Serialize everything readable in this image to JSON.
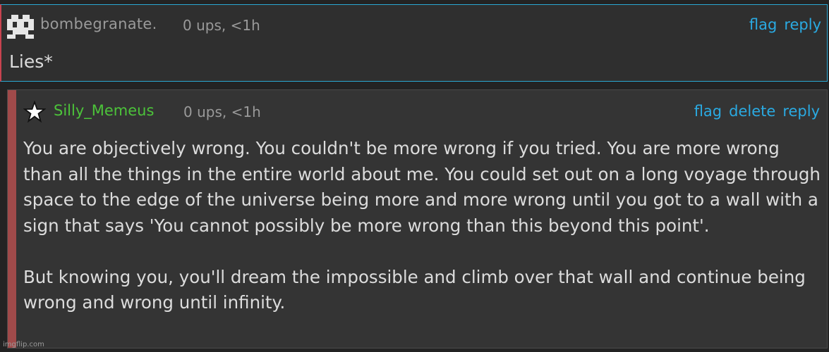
{
  "comment_1": {
    "username": "bombegranate.",
    "meta": "0 ups, <1h",
    "actions": [
      "flag",
      "reply"
    ],
    "text": "Lies*"
  },
  "comment_2": {
    "username": "Silly_Memeus",
    "meta": "0 ups, <1h",
    "actions": [
      "flag",
      "delete",
      "reply"
    ],
    "paragraphs": [
      "You are objectively wrong. You couldn't be more wrong if you tried. You are more wrong than all the things in the entire world about me. You could set out on a long voyage through space to the edge of the universe being more and more wrong until you got to a wall with a sign that says 'You cannot possibly be more wrong than this beyond this point'.",
      "But knowing you, you'll dream the impossible and climb over that wall and continue being wrong and wrong until infinity."
    ]
  },
  "watermark": "imgflip.com",
  "colors": {
    "background": "#232323",
    "comment_bg": "#2f2f2f",
    "link": "#2aaae2",
    "username_green": "#4cc33a",
    "reply_bar": "#a04a4a"
  }
}
